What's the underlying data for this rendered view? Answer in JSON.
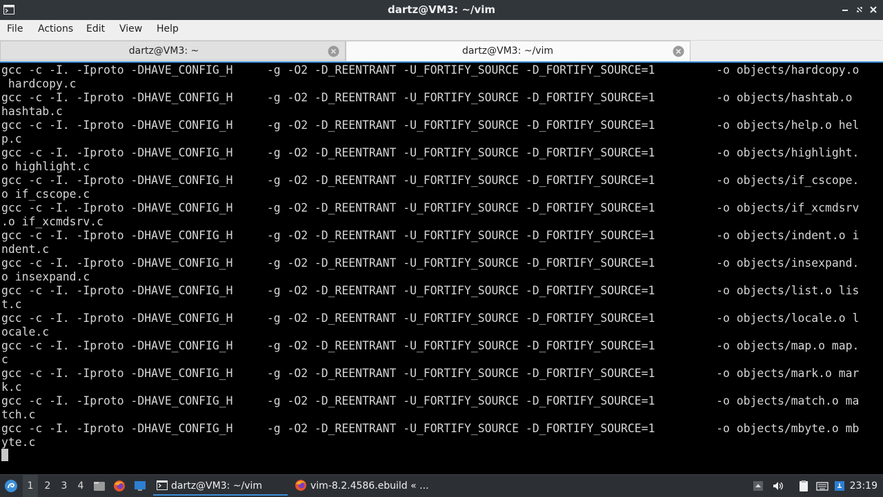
{
  "window": {
    "title": "dartz@VM3: ~/vim"
  },
  "menu": [
    "File",
    "Actions",
    "Edit",
    "View",
    "Help"
  ],
  "tabs": [
    {
      "label": "dartz@VM3: ~",
      "active": false
    },
    {
      "label": "dartz@VM3: ~/vim",
      "active": true
    }
  ],
  "terminal": {
    "lines": [
      "gcc -c -I. -Iproto -DHAVE_CONFIG_H     -g -O2 -D_REENTRANT -U_FORTIFY_SOURCE -D_FORTIFY_SOURCE=1         -o objects/hardcopy.o",
      " hardcopy.c",
      "gcc -c -I. -Iproto -DHAVE_CONFIG_H     -g -O2 -D_REENTRANT -U_FORTIFY_SOURCE -D_FORTIFY_SOURCE=1         -o objects/hashtab.o",
      "hashtab.c",
      "gcc -c -I. -Iproto -DHAVE_CONFIG_H     -g -O2 -D_REENTRANT -U_FORTIFY_SOURCE -D_FORTIFY_SOURCE=1         -o objects/help.o hel",
      "p.c",
      "gcc -c -I. -Iproto -DHAVE_CONFIG_H     -g -O2 -D_REENTRANT -U_FORTIFY_SOURCE -D_FORTIFY_SOURCE=1         -o objects/highlight.",
      "o highlight.c",
      "gcc -c -I. -Iproto -DHAVE_CONFIG_H     -g -O2 -D_REENTRANT -U_FORTIFY_SOURCE -D_FORTIFY_SOURCE=1         -o objects/if_cscope.",
      "o if_cscope.c",
      "gcc -c -I. -Iproto -DHAVE_CONFIG_H     -g -O2 -D_REENTRANT -U_FORTIFY_SOURCE -D_FORTIFY_SOURCE=1         -o objects/if_xcmdsrv",
      ".o if_xcmdsrv.c",
      "gcc -c -I. -Iproto -DHAVE_CONFIG_H     -g -O2 -D_REENTRANT -U_FORTIFY_SOURCE -D_FORTIFY_SOURCE=1         -o objects/indent.o i",
      "ndent.c",
      "gcc -c -I. -Iproto -DHAVE_CONFIG_H     -g -O2 -D_REENTRANT -U_FORTIFY_SOURCE -D_FORTIFY_SOURCE=1         -o objects/insexpand.",
      "o insexpand.c",
      "gcc -c -I. -Iproto -DHAVE_CONFIG_H     -g -O2 -D_REENTRANT -U_FORTIFY_SOURCE -D_FORTIFY_SOURCE=1         -o objects/list.o lis",
      "t.c",
      "gcc -c -I. -Iproto -DHAVE_CONFIG_H     -g -O2 -D_REENTRANT -U_FORTIFY_SOURCE -D_FORTIFY_SOURCE=1         -o objects/locale.o l",
      "ocale.c",
      "gcc -c -I. -Iproto -DHAVE_CONFIG_H     -g -O2 -D_REENTRANT -U_FORTIFY_SOURCE -D_FORTIFY_SOURCE=1         -o objects/map.o map.",
      "c",
      "gcc -c -I. -Iproto -DHAVE_CONFIG_H     -g -O2 -D_REENTRANT -U_FORTIFY_SOURCE -D_FORTIFY_SOURCE=1         -o objects/mark.o mar",
      "k.c",
      "gcc -c -I. -Iproto -DHAVE_CONFIG_H     -g -O2 -D_REENTRANT -U_FORTIFY_SOURCE -D_FORTIFY_SOURCE=1         -o objects/match.o ma",
      "tch.c",
      "gcc -c -I. -Iproto -DHAVE_CONFIG_H     -g -O2 -D_REENTRANT -U_FORTIFY_SOURCE -D_FORTIFY_SOURCE=1         -o objects/mbyte.o mb",
      "yte.c"
    ]
  },
  "taskbar": {
    "workspaces": [
      "1",
      "2",
      "3",
      "4"
    ],
    "active_workspace": "1",
    "tasks": [
      {
        "label": "dartz@VM3: ~/vim",
        "icon": "terminal-icon",
        "active": true
      },
      {
        "label": "vim-8.2.4586.ebuild « ...",
        "icon": "firefox-icon",
        "active": false
      }
    ],
    "clock": "23:19"
  },
  "colors": {
    "accent": "#3b8fd9",
    "terminal_bg": "#000000",
    "terminal_fg": "#d6d6d6",
    "titlebar_bg": "#31363b",
    "taskbar_bg": "#2c3035"
  }
}
